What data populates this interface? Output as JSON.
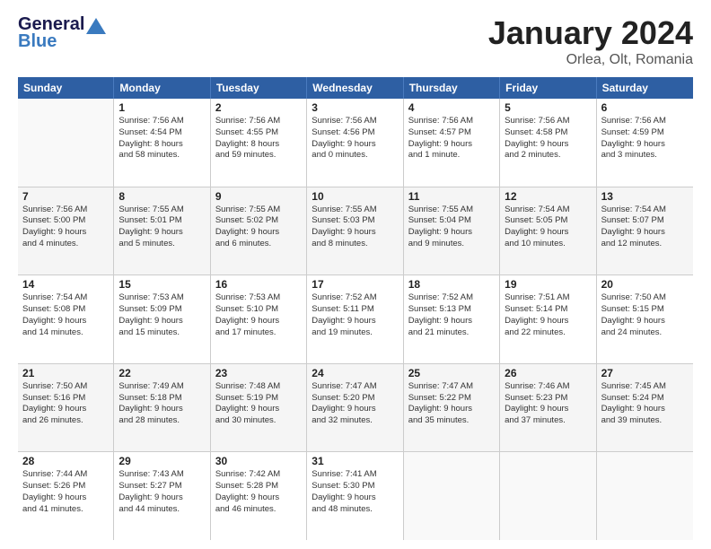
{
  "header": {
    "logo": {
      "general": "General",
      "blue": "Blue"
    },
    "title": "January 2024",
    "subtitle": "Orlea, Olt, Romania"
  },
  "weekdays": [
    "Sunday",
    "Monday",
    "Tuesday",
    "Wednesday",
    "Thursday",
    "Friday",
    "Saturday"
  ],
  "weeks": [
    [
      {
        "day": "",
        "lines": []
      },
      {
        "day": "1",
        "lines": [
          "Sunrise: 7:56 AM",
          "Sunset: 4:54 PM",
          "Daylight: 8 hours",
          "and 58 minutes."
        ]
      },
      {
        "day": "2",
        "lines": [
          "Sunrise: 7:56 AM",
          "Sunset: 4:55 PM",
          "Daylight: 8 hours",
          "and 59 minutes."
        ]
      },
      {
        "day": "3",
        "lines": [
          "Sunrise: 7:56 AM",
          "Sunset: 4:56 PM",
          "Daylight: 9 hours",
          "and 0 minutes."
        ]
      },
      {
        "day": "4",
        "lines": [
          "Sunrise: 7:56 AM",
          "Sunset: 4:57 PM",
          "Daylight: 9 hours",
          "and 1 minute."
        ]
      },
      {
        "day": "5",
        "lines": [
          "Sunrise: 7:56 AM",
          "Sunset: 4:58 PM",
          "Daylight: 9 hours",
          "and 2 minutes."
        ]
      },
      {
        "day": "6",
        "lines": [
          "Sunrise: 7:56 AM",
          "Sunset: 4:59 PM",
          "Daylight: 9 hours",
          "and 3 minutes."
        ]
      }
    ],
    [
      {
        "day": "7",
        "lines": [
          "Sunrise: 7:56 AM",
          "Sunset: 5:00 PM",
          "Daylight: 9 hours",
          "and 4 minutes."
        ]
      },
      {
        "day": "8",
        "lines": [
          "Sunrise: 7:55 AM",
          "Sunset: 5:01 PM",
          "Daylight: 9 hours",
          "and 5 minutes."
        ]
      },
      {
        "day": "9",
        "lines": [
          "Sunrise: 7:55 AM",
          "Sunset: 5:02 PM",
          "Daylight: 9 hours",
          "and 6 minutes."
        ]
      },
      {
        "day": "10",
        "lines": [
          "Sunrise: 7:55 AM",
          "Sunset: 5:03 PM",
          "Daylight: 9 hours",
          "and 8 minutes."
        ]
      },
      {
        "day": "11",
        "lines": [
          "Sunrise: 7:55 AM",
          "Sunset: 5:04 PM",
          "Daylight: 9 hours",
          "and 9 minutes."
        ]
      },
      {
        "day": "12",
        "lines": [
          "Sunrise: 7:54 AM",
          "Sunset: 5:05 PM",
          "Daylight: 9 hours",
          "and 10 minutes."
        ]
      },
      {
        "day": "13",
        "lines": [
          "Sunrise: 7:54 AM",
          "Sunset: 5:07 PM",
          "Daylight: 9 hours",
          "and 12 minutes."
        ]
      }
    ],
    [
      {
        "day": "14",
        "lines": [
          "Sunrise: 7:54 AM",
          "Sunset: 5:08 PM",
          "Daylight: 9 hours",
          "and 14 minutes."
        ]
      },
      {
        "day": "15",
        "lines": [
          "Sunrise: 7:53 AM",
          "Sunset: 5:09 PM",
          "Daylight: 9 hours",
          "and 15 minutes."
        ]
      },
      {
        "day": "16",
        "lines": [
          "Sunrise: 7:53 AM",
          "Sunset: 5:10 PM",
          "Daylight: 9 hours",
          "and 17 minutes."
        ]
      },
      {
        "day": "17",
        "lines": [
          "Sunrise: 7:52 AM",
          "Sunset: 5:11 PM",
          "Daylight: 9 hours",
          "and 19 minutes."
        ]
      },
      {
        "day": "18",
        "lines": [
          "Sunrise: 7:52 AM",
          "Sunset: 5:13 PM",
          "Daylight: 9 hours",
          "and 21 minutes."
        ]
      },
      {
        "day": "19",
        "lines": [
          "Sunrise: 7:51 AM",
          "Sunset: 5:14 PM",
          "Daylight: 9 hours",
          "and 22 minutes."
        ]
      },
      {
        "day": "20",
        "lines": [
          "Sunrise: 7:50 AM",
          "Sunset: 5:15 PM",
          "Daylight: 9 hours",
          "and 24 minutes."
        ]
      }
    ],
    [
      {
        "day": "21",
        "lines": [
          "Sunrise: 7:50 AM",
          "Sunset: 5:16 PM",
          "Daylight: 9 hours",
          "and 26 minutes."
        ]
      },
      {
        "day": "22",
        "lines": [
          "Sunrise: 7:49 AM",
          "Sunset: 5:18 PM",
          "Daylight: 9 hours",
          "and 28 minutes."
        ]
      },
      {
        "day": "23",
        "lines": [
          "Sunrise: 7:48 AM",
          "Sunset: 5:19 PM",
          "Daylight: 9 hours",
          "and 30 minutes."
        ]
      },
      {
        "day": "24",
        "lines": [
          "Sunrise: 7:47 AM",
          "Sunset: 5:20 PM",
          "Daylight: 9 hours",
          "and 32 minutes."
        ]
      },
      {
        "day": "25",
        "lines": [
          "Sunrise: 7:47 AM",
          "Sunset: 5:22 PM",
          "Daylight: 9 hours",
          "and 35 minutes."
        ]
      },
      {
        "day": "26",
        "lines": [
          "Sunrise: 7:46 AM",
          "Sunset: 5:23 PM",
          "Daylight: 9 hours",
          "and 37 minutes."
        ]
      },
      {
        "day": "27",
        "lines": [
          "Sunrise: 7:45 AM",
          "Sunset: 5:24 PM",
          "Daylight: 9 hours",
          "and 39 minutes."
        ]
      }
    ],
    [
      {
        "day": "28",
        "lines": [
          "Sunrise: 7:44 AM",
          "Sunset: 5:26 PM",
          "Daylight: 9 hours",
          "and 41 minutes."
        ]
      },
      {
        "day": "29",
        "lines": [
          "Sunrise: 7:43 AM",
          "Sunset: 5:27 PM",
          "Daylight: 9 hours",
          "and 44 minutes."
        ]
      },
      {
        "day": "30",
        "lines": [
          "Sunrise: 7:42 AM",
          "Sunset: 5:28 PM",
          "Daylight: 9 hours",
          "and 46 minutes."
        ]
      },
      {
        "day": "31",
        "lines": [
          "Sunrise: 7:41 AM",
          "Sunset: 5:30 PM",
          "Daylight: 9 hours",
          "and 48 minutes."
        ]
      },
      {
        "day": "",
        "lines": []
      },
      {
        "day": "",
        "lines": []
      },
      {
        "day": "",
        "lines": []
      }
    ]
  ]
}
